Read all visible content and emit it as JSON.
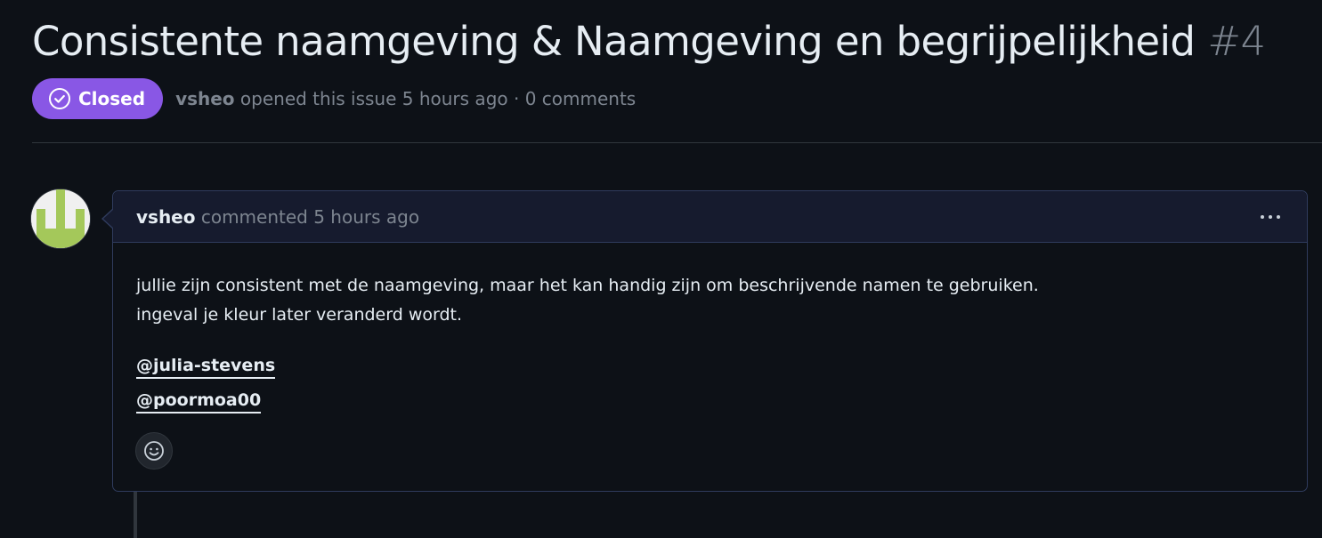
{
  "issue": {
    "title": "Consistente naamgeving & Naamgeving en begrijpelijkheid",
    "number": "#4",
    "state": "Closed",
    "author": "vsheo",
    "meta_suffix": "opened this issue 5 hours ago · 0 comments"
  },
  "comment": {
    "author": "vsheo",
    "header_suffix": "commented 5 hours ago",
    "body_line_1": "jullie zijn consistent met de naamgeving, maar het kan handig zijn om beschrijvende namen te gebruiken.",
    "body_line_2": "ingeval je kleur later veranderd wordt.",
    "mentions": [
      "@julia-stevens",
      "@poormoa00"
    ]
  },
  "colors": {
    "closed_badge": "#8957e5",
    "background": "#0d1117",
    "comment_header": "#161b2e",
    "avatar_green": "#a4c85a"
  },
  "icons": {
    "state": "check-circle-icon",
    "reaction": "smiley-icon",
    "menu": "kebab-horizontal-icon"
  }
}
